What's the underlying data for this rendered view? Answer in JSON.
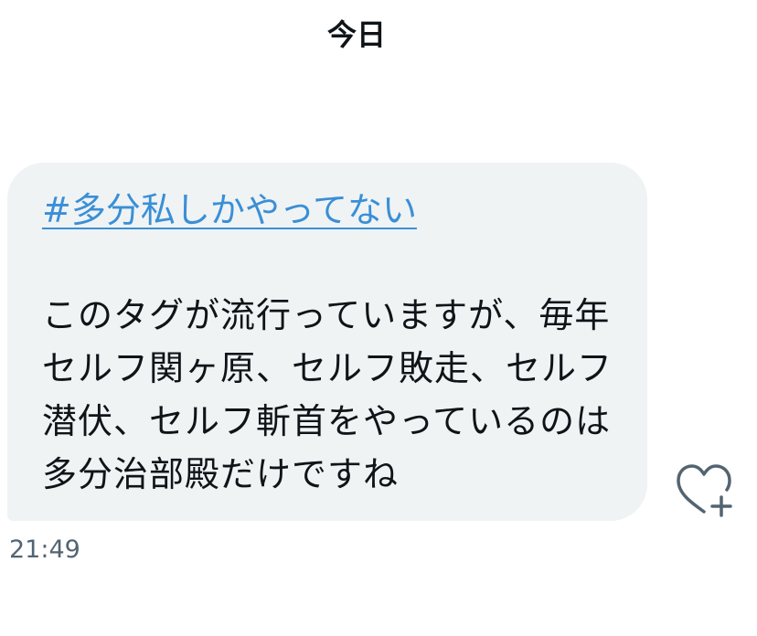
{
  "date_header": "今日",
  "message": {
    "hashtag": "#多分私しかやってない",
    "body": "このタグが流行っていますが、毎年セルフ関ヶ原、セルフ敗走、セルフ潜伏、セルフ斬首をやっているのは多分治部殿だけですね",
    "time": "21:49"
  },
  "icons": {
    "like": "heart-plus-icon"
  },
  "colors": {
    "bubble": "#eff3f4",
    "link": "#3a8fd6",
    "text": "#0f1419",
    "muted": "#536471"
  }
}
